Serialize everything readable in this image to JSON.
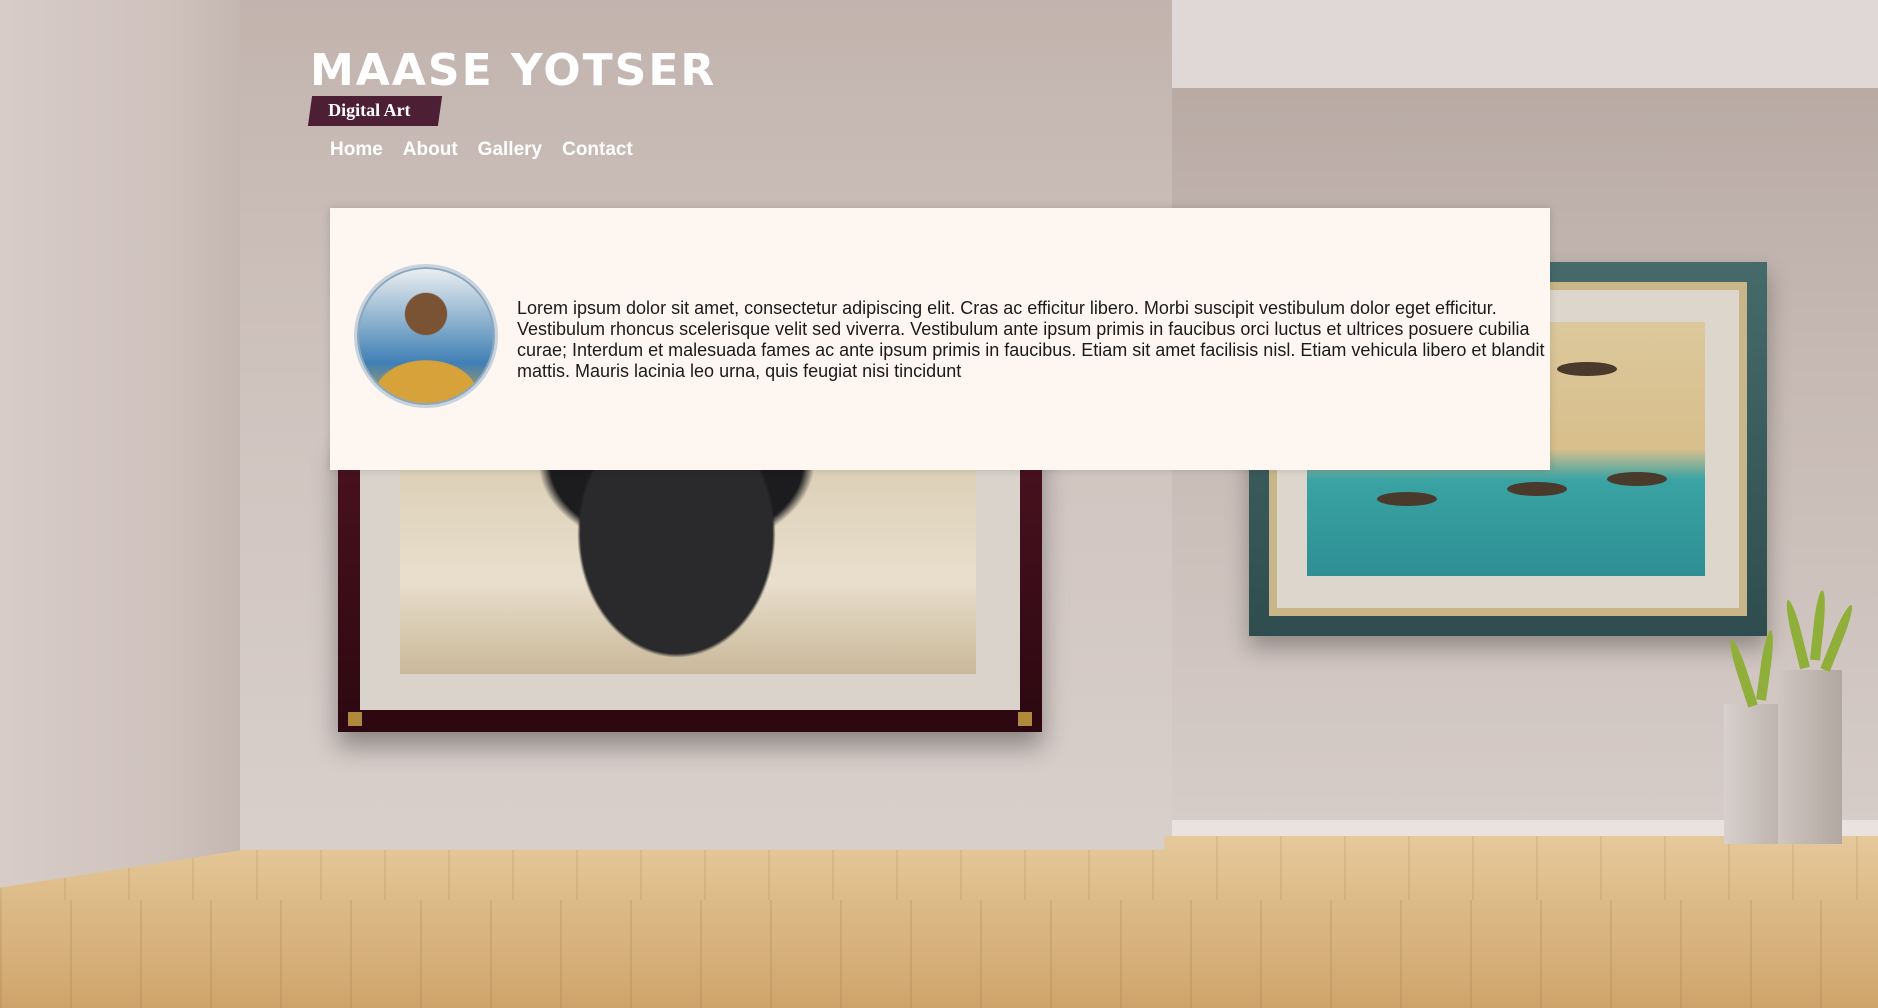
{
  "brand": {
    "name": "MAASE YOTSER",
    "tagline": "Digital Art"
  },
  "nav": [
    {
      "label": "Home"
    },
    {
      "label": "About"
    },
    {
      "label": "Gallery"
    },
    {
      "label": "Contact"
    }
  ],
  "about": {
    "bio": "Lorem ipsum dolor sit amet, consectetur adipiscing elit. Cras ac efficitur libero. Morbi suscipit vestibulum dolor eget efficitur. Vestibulum rhoncus scelerisque velit sed viverra. Vestibulum ante ipsum primis in faucibus orci luctus et ultrices posuere cubilia curae; Interdum et malesuada fames ac ante ipsum primis in faucibus. Etiam sit amet facilisis nisl. Etiam vehicula libero et blandit mattis. Mauris lacinia leo urna, quis feugiat nisi tincidunt"
  },
  "colors": {
    "tag_background": "#4d1f34",
    "card_background": "#fdf6f1",
    "nav_text": "#ffffff"
  }
}
